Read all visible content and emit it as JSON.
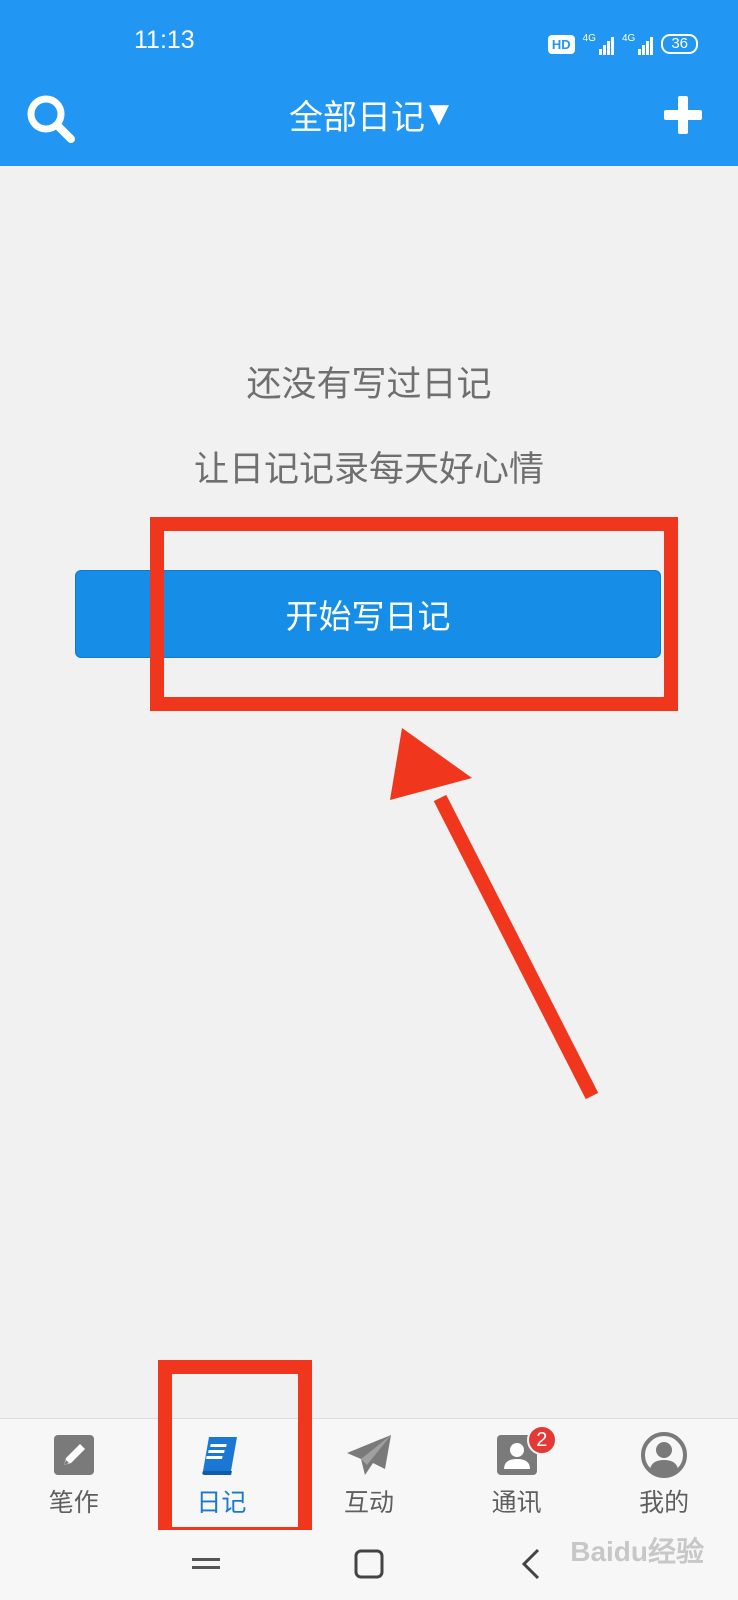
{
  "status_bar": {
    "time": "11:13",
    "hd_label": "HD",
    "network_1": "4G",
    "network_2": "4G",
    "battery": "36"
  },
  "header": {
    "title": "全部日记",
    "title_caret": "▼",
    "search_icon": "search-icon",
    "add_icon": "plus-icon",
    "background_color": "#2196f3"
  },
  "empty_state": {
    "line1": "还没有写过日记",
    "line2": "让日记记录每天好心情",
    "button_label": "开始写日记",
    "button_color": "#168de7"
  },
  "annotations": {
    "highlight_color": "#f0361c"
  },
  "bottom_nav": {
    "items": [
      {
        "label": "笔作",
        "icon": "pencil-icon",
        "active": false
      },
      {
        "label": "日记",
        "icon": "book-icon",
        "active": true
      },
      {
        "label": "互动",
        "icon": "paper-plane-icon",
        "active": false
      },
      {
        "label": "通讯",
        "icon": "contacts-icon",
        "active": false,
        "badge": "2"
      },
      {
        "label": "我的",
        "icon": "user-icon",
        "active": false
      }
    ],
    "active_color": "#1a78d4"
  },
  "system_nav": {
    "buttons": [
      "menu-icon",
      "home-icon",
      "back-icon"
    ]
  },
  "watermark": "Baidu经验"
}
